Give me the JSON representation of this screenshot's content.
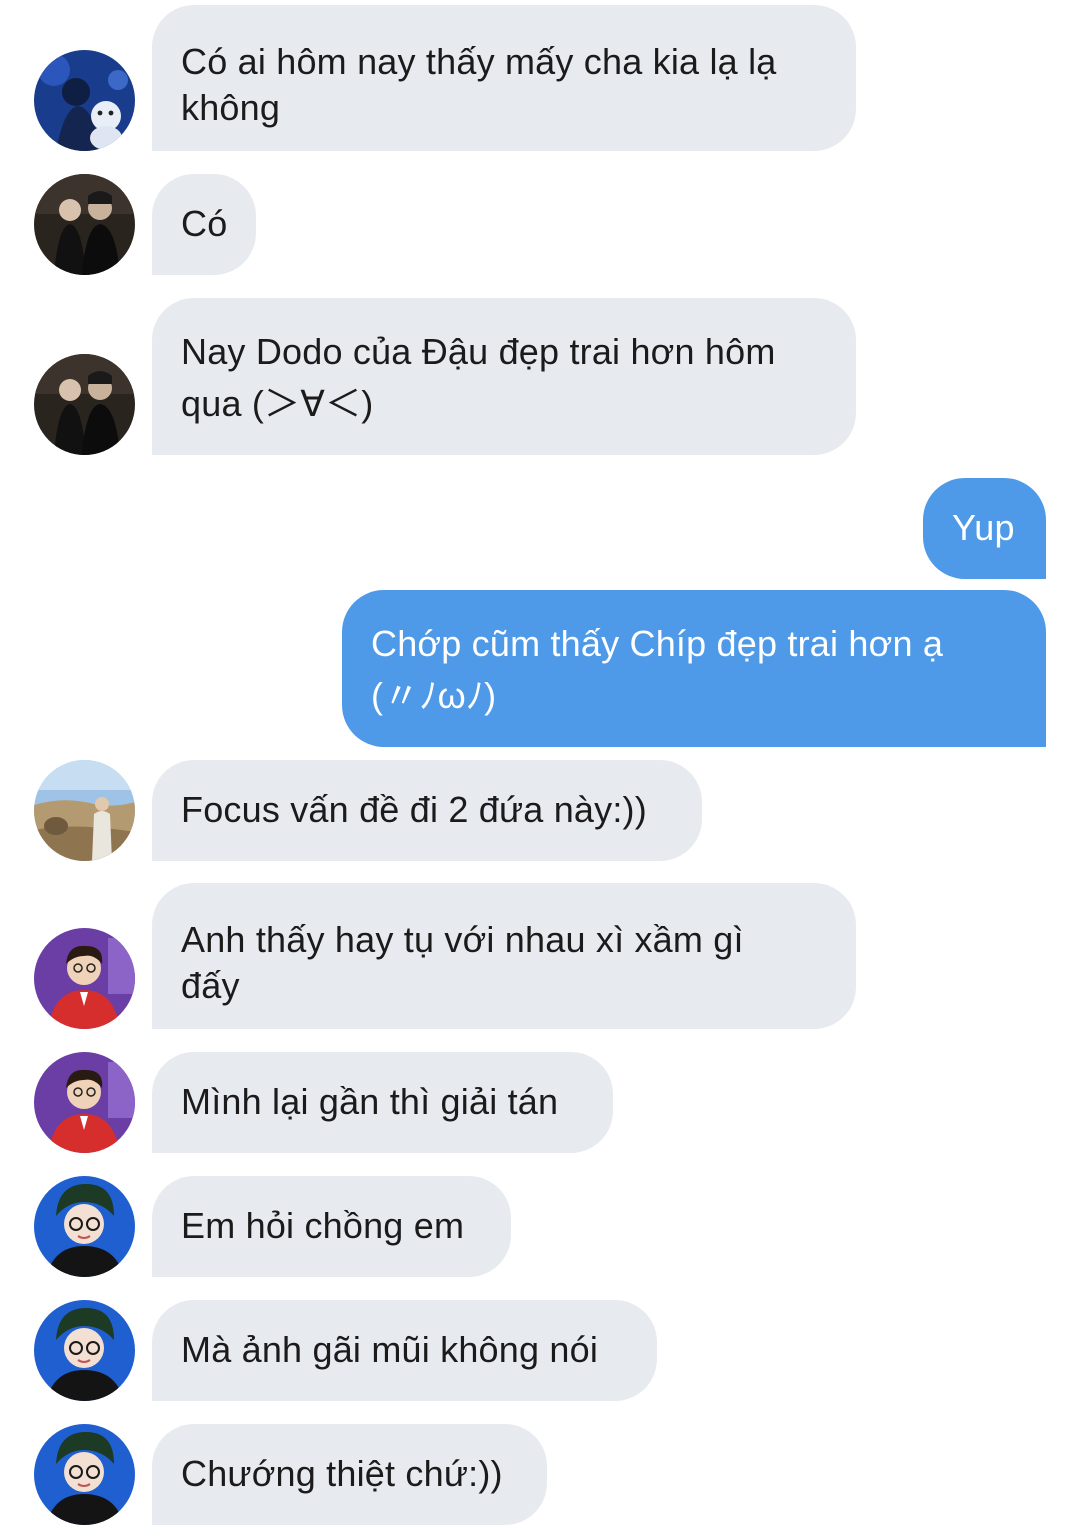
{
  "messages": [
    {
      "direction": "in",
      "avatar": "avatar-user-1",
      "text": "Có ai hôm nay thấy mấy cha kia lạ lạ\nkhông"
    },
    {
      "direction": "in",
      "avatar": "avatar-user-2",
      "text": "Có"
    },
    {
      "direction": "in",
      "avatar": "avatar-user-2",
      "text": "Nay Dodo của Đậu đẹp trai hơn hôm\nqua (＞∀＜)"
    },
    {
      "direction": "out",
      "text": "Yup"
    },
    {
      "direction": "out",
      "text": "Chớp cũm thấy Chíp đẹp trai hơn ạ\n(〃ﾉωﾉ)"
    },
    {
      "direction": "in",
      "avatar": "avatar-user-3",
      "text": "Focus vấn đề đi 2 đứa này:))"
    },
    {
      "direction": "in",
      "avatar": "avatar-user-4",
      "text": "Anh thấy hay tụ với nhau xì xầm gì\nđấy"
    },
    {
      "direction": "in",
      "avatar": "avatar-user-4",
      "text": "Mình lại gần thì giải tán"
    },
    {
      "direction": "in",
      "avatar": "avatar-user-5",
      "text": "Em hỏi chồng em"
    },
    {
      "direction": "in",
      "avatar": "avatar-user-5",
      "text": "Mà ảnh gãi mũi không nói"
    },
    {
      "direction": "in",
      "avatar": "avatar-user-5",
      "text": "Chướng thiệt chứ:))"
    }
  ],
  "colors": {
    "incoming_bubble": "#e7ebf0",
    "outgoing_bubble": "#4e9ae8",
    "incoming_text": "#1b1b1b",
    "outgoing_text": "#ffffff"
  }
}
